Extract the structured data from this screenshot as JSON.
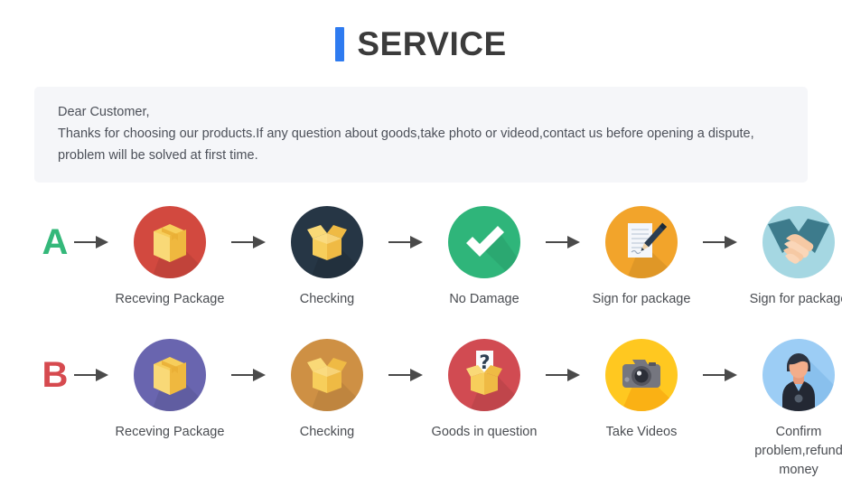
{
  "header": {
    "title": "SERVICE",
    "accent_color": "#2E7BF0"
  },
  "notice": {
    "line1": "Dear Customer,",
    "line2": "Thanks for choosing our products.If any question about goods,take photo or videod,contact us before opening a dispute,",
    "line3": "problem will be solved at first time.",
    "background_color": "#F5F6F9"
  },
  "flows": [
    {
      "letter": "A",
      "letter_color": "#34B87A",
      "steps": [
        {
          "label": "Receving Package",
          "icon": "package-box-icon",
          "circle_color": "#D2493F"
        },
        {
          "label": "Checking",
          "icon": "open-box-icon",
          "circle_color": "#263645"
        },
        {
          "label": "No Damage",
          "icon": "checkmark-icon",
          "circle_color": "#2FB57A"
        },
        {
          "label": "Sign for package",
          "icon": "document-pen-icon",
          "circle_color": "#F2A42B"
        },
        {
          "label": "Sign for package",
          "icon": "handshake-icon",
          "circle_color": "#A5D7E2"
        }
      ]
    },
    {
      "letter": "B",
      "letter_color": "#D64A4F",
      "steps": [
        {
          "label": "Receving Package",
          "icon": "package-box-icon",
          "circle_color": "#6965AF"
        },
        {
          "label": "Checking",
          "icon": "open-box-icon",
          "circle_color": "#CE9044"
        },
        {
          "label": "Goods in question",
          "icon": "question-box-icon",
          "circle_color": "#D14B52"
        },
        {
          "label": "Take Videos",
          "icon": "camera-icon",
          "circle_color": "#FFC820"
        },
        {
          "label": "Confirm problem,refund money",
          "icon": "person-avatar-icon",
          "circle_color": "#9CCDF5"
        }
      ]
    }
  ],
  "arrow": {
    "icon": "arrow-right-icon",
    "color": "#4a4a4a"
  }
}
